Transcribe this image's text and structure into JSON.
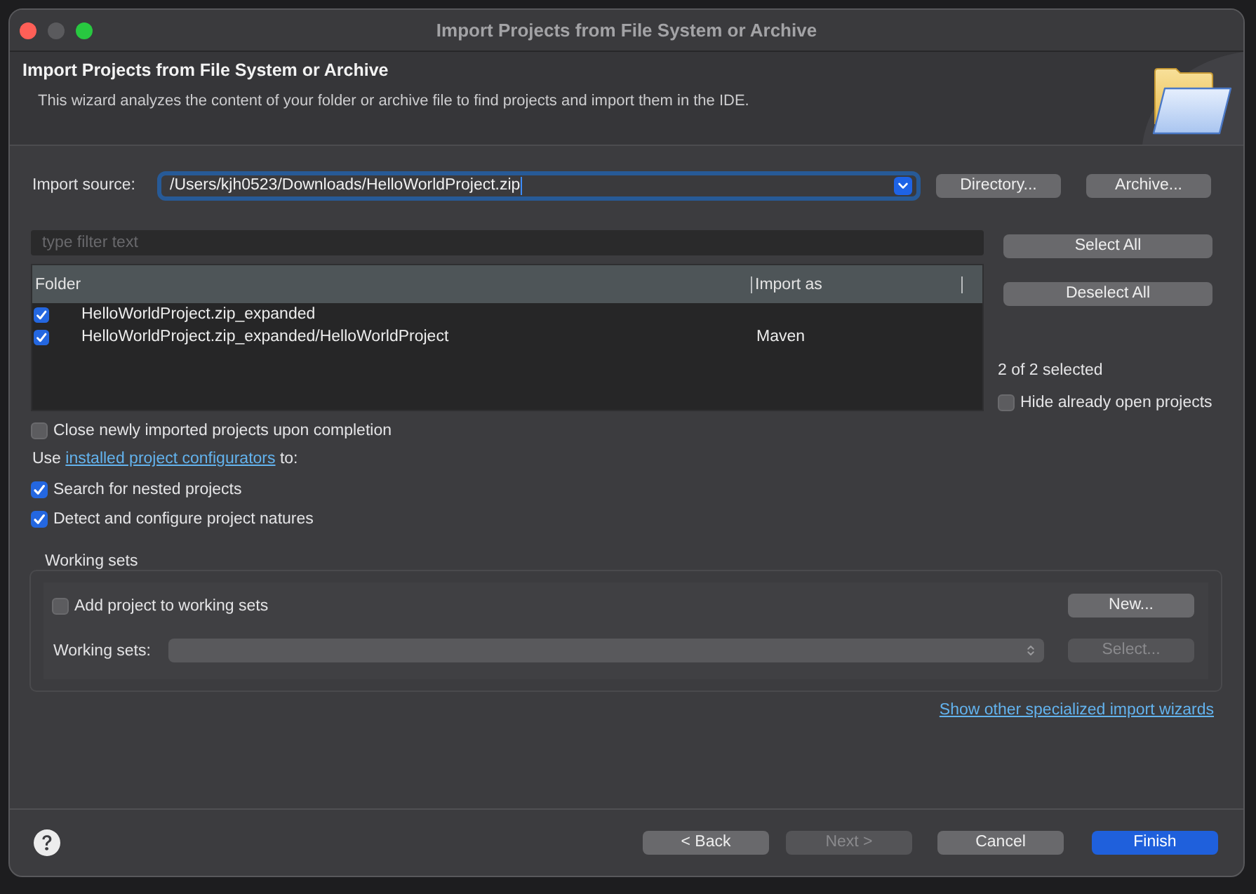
{
  "window": {
    "title": "Import Projects from File System or Archive",
    "controls": [
      {
        "kind": "close",
        "disabled": false
      },
      {
        "kind": "minimize",
        "disabled": true
      },
      {
        "kind": "zoom",
        "disabled": false
      }
    ]
  },
  "header": {
    "title": "Import Projects from File System or Archive",
    "description": "This wizard analyzes the content of your folder or archive file to find projects and import them in the IDE."
  },
  "import_source": {
    "label": "Import source:",
    "value": "/Users/kjh0523/Downloads/HelloWorldProject.zip",
    "focused": true,
    "buttons": [
      {
        "label": "Directory..."
      },
      {
        "label": "Archive..."
      }
    ]
  },
  "filter": {
    "placeholder": "type filter text"
  },
  "table": {
    "columns": [
      "Folder",
      "Import as"
    ],
    "rows": [
      {
        "checked": true,
        "folder": "HelloWorldProject.zip_expanded"
      },
      {
        "checked": true,
        "folder": "HelloWorldProject.zip_expanded/HelloWorldProject",
        "import_as": "Maven"
      }
    ]
  },
  "selection": {
    "buttons": [
      {
        "label": "Select All"
      },
      {
        "label": "Deselect All"
      }
    ],
    "summary": "2 of 2 selected",
    "hide_open": {
      "label": "Hide already open projects",
      "checked": false
    }
  },
  "close_on_completion": {
    "label": "Close newly imported projects upon completion",
    "checked": false
  },
  "configurators": {
    "before": "Use ",
    "link": "installed project configurators",
    "after": " to:",
    "options": [
      {
        "label": "Search for nested projects",
        "checked": true
      },
      {
        "label": "Detect and configure project natures",
        "checked": true
      }
    ]
  },
  "working_sets": {
    "title": "Working sets",
    "add": {
      "label": "Add project to working sets",
      "checked": false
    },
    "new_button": {
      "label": "New...",
      "disabled": false
    },
    "combo_label": "Working sets:",
    "combo": {
      "disabled": true
    },
    "select_button": {
      "label": "Select...",
      "disabled": true
    }
  },
  "other_wizards_link": "Show other specialized import wizards",
  "footer": {
    "buttons": [
      {
        "label": "< Back",
        "default": false,
        "disabled": false
      },
      {
        "label": "Next >",
        "default": false,
        "disabled": true
      },
      {
        "label": "Cancel",
        "default": false,
        "disabled": false
      },
      {
        "label": "Finish",
        "default": true,
        "disabled": false
      }
    ]
  }
}
